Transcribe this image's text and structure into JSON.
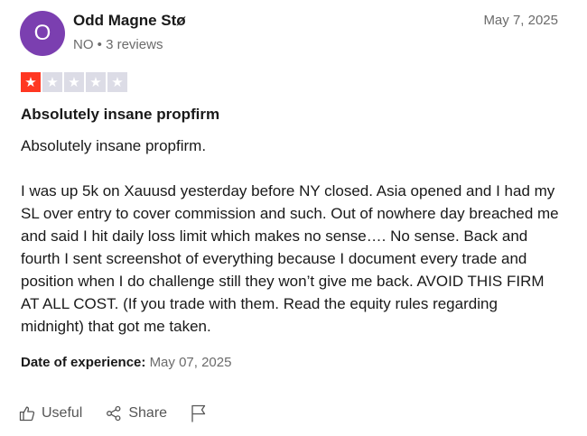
{
  "reviewer": {
    "avatar_initial": "O",
    "avatar_color": "#7b3fb0",
    "name": "Odd Magne Stø",
    "meta": "NO • 3 reviews"
  },
  "review": {
    "date": "May 7, 2025",
    "rating": 1,
    "rating_max": 5,
    "rating_color": "#ff3722",
    "empty_star_color": "#dcdce6",
    "title": "Absolutely insane propfirm",
    "paragraphs": [
      "Absolutely insane propfirm.",
      "I was up 5k on Xauusd yesterday before NY closed. Asia opened and I had my SL over entry to cover commission and such. Out of nowhere day breached me and said I hit daily loss limit which makes no sense…. No sense. Back and fourth I sent screenshot of everything because I document every trade and position when I do challenge still they won’t give me back. AVOID THIS FIRM AT ALL COST. (If you trade with them. Read the equity rules regarding midnight) that got me taken."
    ],
    "experience_label": "Date of experience:",
    "experience_date": "May 07, 2025"
  },
  "actions": {
    "useful_label": "Useful",
    "useful_icon": "thumbs-up-icon",
    "share_label": "Share",
    "share_icon": "share-icon",
    "report_icon": "flag-icon"
  }
}
